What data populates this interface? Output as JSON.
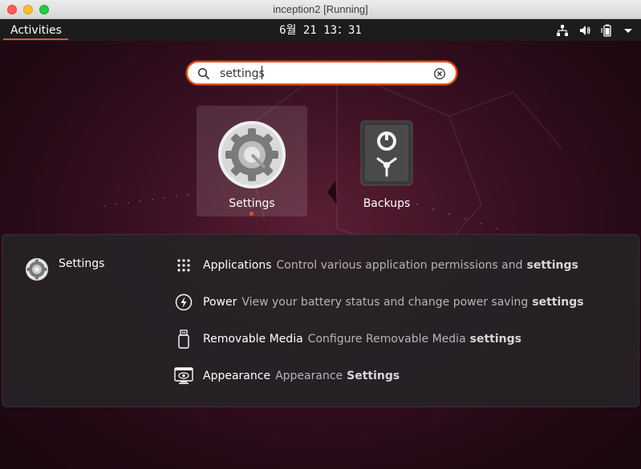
{
  "window": {
    "title": "inception2 [Running]"
  },
  "topbar": {
    "activities": "Activities",
    "clock": "6월 21  13：31"
  },
  "search": {
    "value": "settings"
  },
  "apps": [
    {
      "label": "Settings"
    },
    {
      "label": "Backups"
    }
  ],
  "results": {
    "provider": "Settings",
    "items": [
      {
        "title": "Applications",
        "desc": "Control various application permissions and",
        "highlight": "settings",
        "icon": "apps-grid-icon"
      },
      {
        "title": "Power",
        "desc": "View your battery status and change power saving",
        "highlight": "settings",
        "icon": "power-icon"
      },
      {
        "title": "Removable Media",
        "desc": "Configure Removable Media",
        "highlight": "settings",
        "icon": "usb-drive-icon"
      },
      {
        "title": "Appearance",
        "desc": "Appearance",
        "highlight": "Settings",
        "icon": "appearance-icon"
      }
    ]
  },
  "colors": {
    "accent": "#e95420",
    "panel": "#262226",
    "topbar": "#1c1c1c"
  }
}
